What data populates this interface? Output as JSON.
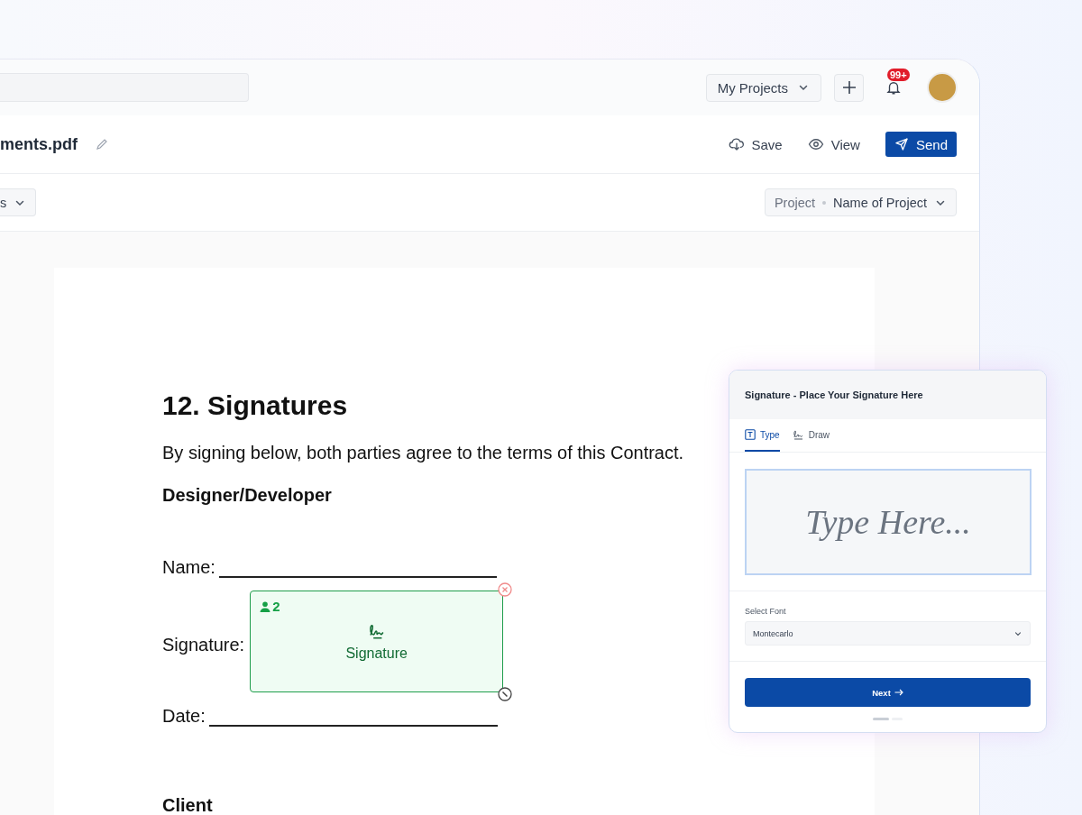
{
  "header": {
    "project_menu": "My Projects",
    "notification_badge": "99+"
  },
  "toolbar": {
    "file_name": "ments.pdf",
    "actions": [
      {
        "label": "Save",
        "kind": "save"
      },
      {
        "label": "View",
        "kind": "view"
      },
      {
        "label": "Send",
        "kind": "send"
      }
    ]
  },
  "filter_bar": {
    "left_dropdown": "s",
    "project_dropdown": {
      "label": "Project",
      "value": "Name of Project"
    }
  },
  "document": {
    "heading": "12. Signatures",
    "intro": "By signing below, both parties agree to the terms of this Contract.",
    "section": "Designer/Developer",
    "fields": [
      {
        "label": "Name:",
        "kind": "line"
      },
      {
        "label": "Signature:",
        "kind": "signature"
      },
      {
        "label": "Date:",
        "kind": "line"
      }
    ],
    "next_section": "Client"
  },
  "signature_field": {
    "signer": "2",
    "label": "Signature"
  },
  "signature_panel": {
    "title": "Signature - Place Your Signature Here",
    "tabs": [
      {
        "label": "Type",
        "kind": "type",
        "selected": true
      },
      {
        "label": "Draw",
        "kind": "draw",
        "selected": false
      }
    ],
    "placeholder": "Type Here...",
    "font_label": "Select Font",
    "font_value": "Montecarlo",
    "next_button": "Next",
    "steps": [
      {
        "selected": true
      },
      {
        "selected": false
      }
    ]
  }
}
